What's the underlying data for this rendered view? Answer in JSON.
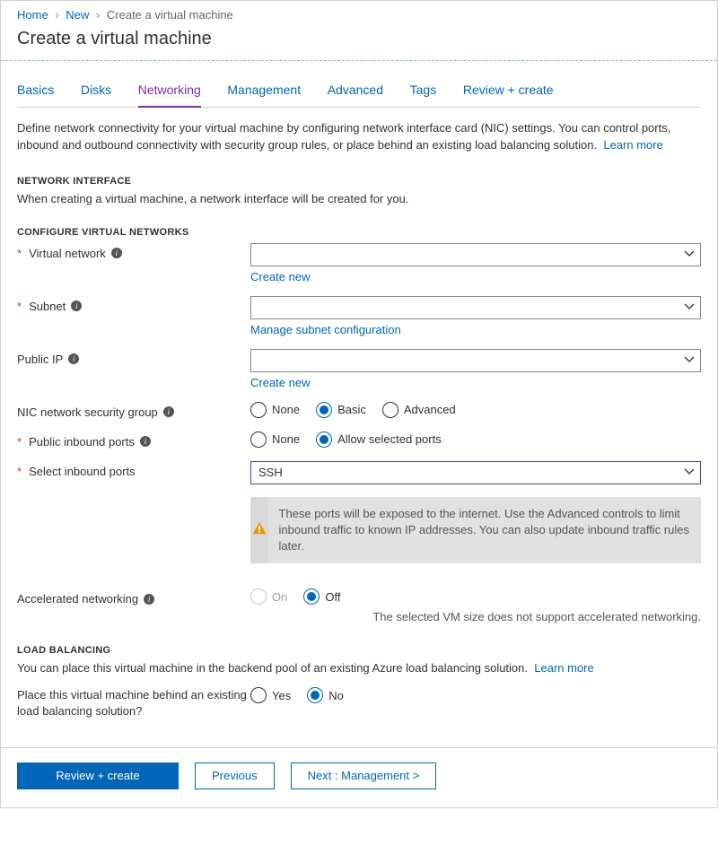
{
  "breadcrumb": {
    "home": "Home",
    "new": "New",
    "current": "Create a virtual machine"
  },
  "title": "Create a virtual machine",
  "tabs": {
    "basics": "Basics",
    "disks": "Disks",
    "networking": "Networking",
    "management": "Management",
    "advanced": "Advanced",
    "tags": "Tags",
    "review": "Review + create"
  },
  "intro": "Define network connectivity for your virtual machine by configuring network interface card (NIC) settings. You can control ports, inbound and outbound connectivity with security group rules, or place behind an existing load balancing solution.",
  "learn_more": "Learn more",
  "sections": {
    "network_interface": "NETWORK INTERFACE",
    "ni_note": "When creating a virtual machine, a network interface will be created for you.",
    "configure_vn": "CONFIGURE VIRTUAL NETWORKS",
    "load_balancing": "LOAD BALANCING",
    "lb_note": "You can place this virtual machine in the backend pool of an existing Azure load balancing solution."
  },
  "fields": {
    "virtual_network": {
      "label": "Virtual network",
      "value": "",
      "link": "Create new"
    },
    "subnet": {
      "label": "Subnet",
      "value": "",
      "link": "Manage subnet configuration"
    },
    "public_ip": {
      "label": "Public IP",
      "value": "",
      "link": "Create new"
    },
    "nic_sg": {
      "label": "NIC network security group",
      "options": {
        "none": "None",
        "basic": "Basic",
        "advanced": "Advanced"
      }
    },
    "public_inbound": {
      "label": "Public inbound ports",
      "options": {
        "none": "None",
        "allow": "Allow selected ports"
      }
    },
    "select_inbound": {
      "label": "Select inbound ports",
      "value": "SSH"
    },
    "warning": "These ports will be exposed to the internet. Use the Advanced controls to limit inbound traffic to known IP addresses. You can also update inbound traffic rules later.",
    "accel_net": {
      "label": "Accelerated networking",
      "options": {
        "on": "On",
        "off": "Off"
      },
      "hint": "The selected VM size does not support accelerated networking."
    },
    "placement": {
      "label": "Place this virtual machine behind an existing load balancing solution?",
      "options": {
        "yes": "Yes",
        "no": "No"
      }
    }
  },
  "footer": {
    "review": "Review + create",
    "previous": "Previous",
    "next": "Next : Management >"
  }
}
